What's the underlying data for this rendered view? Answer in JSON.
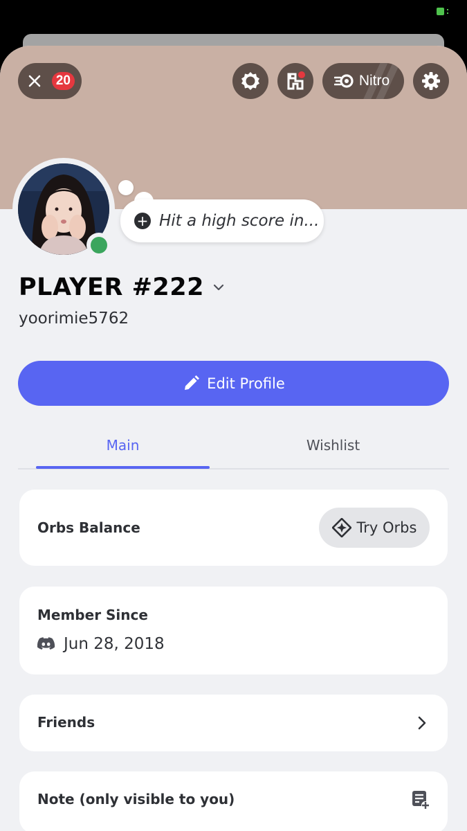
{
  "header": {
    "notification_count": "20",
    "nitro_label": "Nitro"
  },
  "profile": {
    "custom_status": "Hit a high score in...",
    "display_name": "PLAYER #222",
    "username": "yoorimie5762",
    "edit_button_label": "Edit Profile"
  },
  "tabs": [
    {
      "label": "Main",
      "active": true
    },
    {
      "label": "Wishlist",
      "active": false
    }
  ],
  "cards": {
    "orbs": {
      "label": "Orbs Balance",
      "button_label": "Try Orbs"
    },
    "member": {
      "label": "Member Since",
      "date": "Jun 28, 2018"
    },
    "friends": {
      "label": "Friends"
    },
    "note": {
      "label": "Note (only visible to you)"
    }
  },
  "colors": {
    "accent": "#5865f2",
    "banner": "#c9b0a4",
    "online": "#3ba55d",
    "badge": "#e5383f"
  },
  "icons": [
    "close-icon",
    "quests-icon",
    "shop-icon",
    "nitro-icon",
    "gear-icon",
    "add-status-icon",
    "chevron-down-icon",
    "pencil-icon",
    "orb-icon",
    "discord-logo-icon",
    "chevron-right-icon",
    "note-add-icon"
  ]
}
